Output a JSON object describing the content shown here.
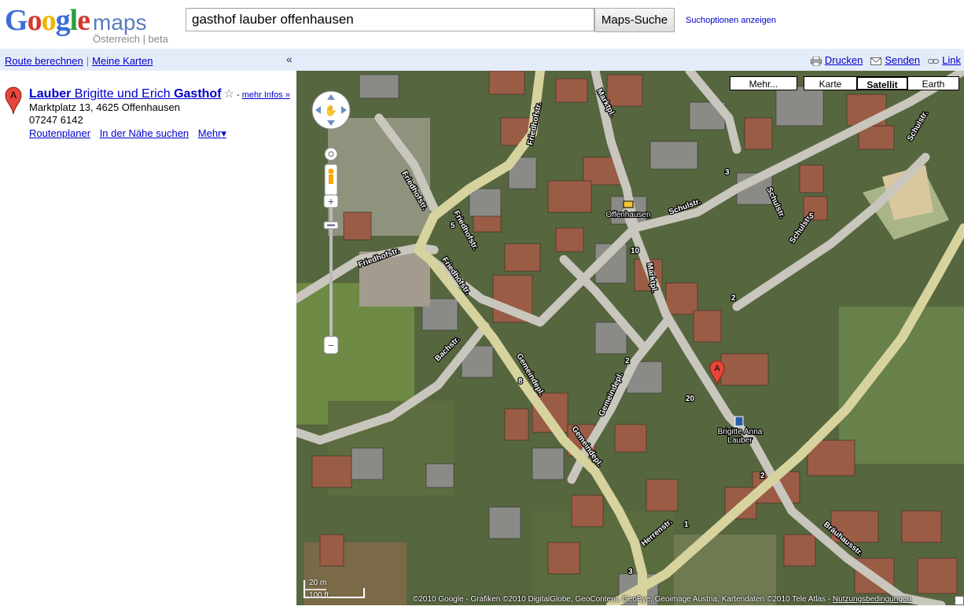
{
  "logo": {
    "google": "Google",
    "maps": "maps",
    "sub": "Österreich | beta"
  },
  "search": {
    "value": "gasthof lauber offenhausen",
    "button": "Maps-Suche",
    "options": "Suchoptionen anzeigen"
  },
  "topbar": {
    "route": "Route berechnen",
    "mymaps": "Meine Karten",
    "collapse": "«",
    "print": "Drucken",
    "send": "Senden",
    "link": "Link"
  },
  "result": {
    "marker": "A",
    "title_part1": "Lauber",
    "title_part2": " Brigitte und Erich ",
    "title_part3": "Gasthof",
    "more_info": "mehr Infos »",
    "address": "Marktplatz 13, 4625 Offenhausen",
    "phone": "07247 6142",
    "directions": "Routenplaner",
    "nearby": "In der Nähe suchen",
    "more": "Mehr▾"
  },
  "map": {
    "types": {
      "more": "Mehr...",
      "map": "Karte",
      "satellite": "Satellit",
      "earth": "Earth",
      "selected": "Satellit"
    },
    "labels": {
      "friedhofstr": "Friedhofstr.",
      "marktpl": "Marktpl.",
      "schulstr": "Schulstr.",
      "gemeindepl": "Gemeindepl.",
      "bachstr": "Bachstr.",
      "herrenstr": "Herrenstr.",
      "brauhausstr": "Bräuhausstr.",
      "offenhausen": "Offenhausen",
      "brigitte": "Brigitte Anna",
      "lauber": "Lauber",
      "num_3": "3",
      "num_2": "2",
      "num_5": "5",
      "num_1": "1",
      "num_8": "8",
      "num_20": "20",
      "num_10": "10"
    },
    "marker": "A",
    "scale_m": "20 m",
    "scale_ft": "100 ft",
    "copyright": "©2010 Google - Grafiken ©2010 DigitalGlobe, GeoContent, GeoEye, Geoimage Austria, Kartendaten ©2010 Tele Atlas - ",
    "terms": "Nutzungsbedingungen"
  },
  "colors": {
    "link": "#0000cc",
    "topbar_bg": "#e5ecf9",
    "marker": "#e8463a"
  }
}
